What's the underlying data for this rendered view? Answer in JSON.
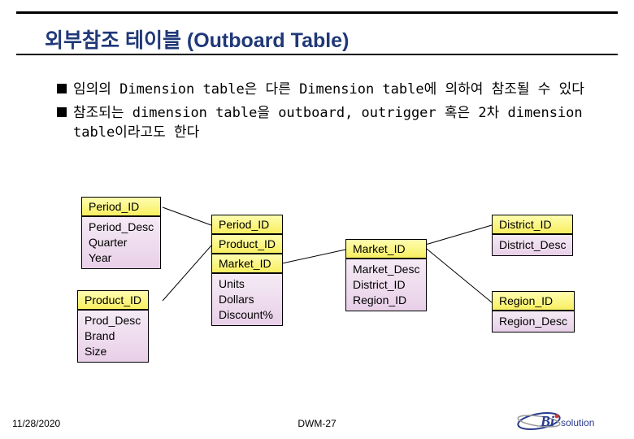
{
  "title": "외부참조 테이블 (Outboard Table)",
  "bullets": [
    "임의의 Dimension table은 다른 Dimension table에 의하여 참조될 수 있다",
    "참조되는 dimension table을 outboard, outrigger 혹은 2차 dimension table이라고도 한다"
  ],
  "tables": {
    "period": {
      "header": "Period_ID",
      "body": "Period_Desc\nQuarter\nYear"
    },
    "product": {
      "header": "Product_ID",
      "body": "Prod_Desc\nBrand\nSize"
    },
    "fact": {
      "r1": "Period_ID",
      "r2": "Product_ID",
      "r3": "Market_ID",
      "body": "Units\nDollars\nDiscount%"
    },
    "market": {
      "header": "Market_ID",
      "body": "Market_Desc\nDistrict_ID\nRegion_ID"
    },
    "district": {
      "header": "District_ID",
      "body": "District_Desc"
    },
    "region": {
      "header": "Region_ID",
      "body": "Region_Desc"
    }
  },
  "footer": {
    "date": "11/28/2020",
    "page": "DWM-27"
  },
  "logo": {
    "text_main": "Bi",
    "text_sub": "solution",
    "colors": {
      "swoosh1": "#2a3c8c",
      "swoosh2": "#888",
      "dot": "#d43a2a"
    }
  }
}
